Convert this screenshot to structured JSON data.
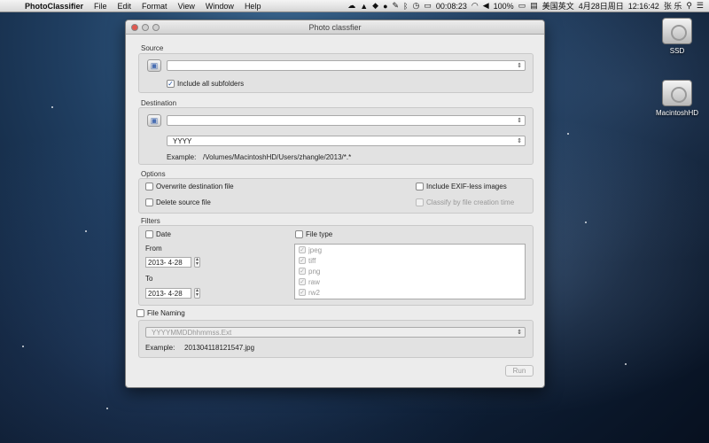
{
  "menubar": {
    "app_name": "PhotoClassifier",
    "menus": [
      "File",
      "Edit",
      "Format",
      "View",
      "Window",
      "Help"
    ],
    "timer": "00:08:23",
    "battery": "100%",
    "input_source": "美国英文",
    "date": "4月28日周日",
    "time": "12:16:42",
    "user": "张 乐"
  },
  "desktop": {
    "icons": [
      {
        "label": "SSD"
      },
      {
        "label": "MacintoshHD"
      }
    ]
  },
  "window": {
    "title": "Photo classfier",
    "source": {
      "label": "Source",
      "path_value": "",
      "include_subfolders_label": "Include all subfolders",
      "include_subfolders_checked": true
    },
    "destination": {
      "label": "Destination",
      "path_value": "",
      "pattern_value": "YYYY",
      "example_label": "Example:",
      "example_value": "/Volumes/MacintoshHD/Users/zhangle/2013/*.*"
    },
    "options": {
      "label": "Options",
      "overwrite_label": "Overwrite destination file",
      "delete_label": "Delete source file",
      "exif_label": "Include EXIF-less images",
      "creation_time_label": "Classify by file creation time"
    },
    "filters": {
      "label": "Filters",
      "date_label": "Date",
      "from_label": "From",
      "from_value": "2013- 4-28",
      "to_label": "To",
      "to_value": "2013- 4-28",
      "file_type_label": "File type",
      "file_types": [
        "jpeg",
        "tiff",
        "png",
        "raw",
        "rw2"
      ]
    },
    "naming": {
      "label": "File Naming",
      "pattern_value": "YYYYMMDDhhmmss.Ext",
      "example_label": "Example:",
      "example_value": "201304118121547.jpg"
    },
    "run_label": "Run"
  },
  "colors": {
    "accent": "#1d4fa3",
    "close_button": "#e0584f"
  }
}
